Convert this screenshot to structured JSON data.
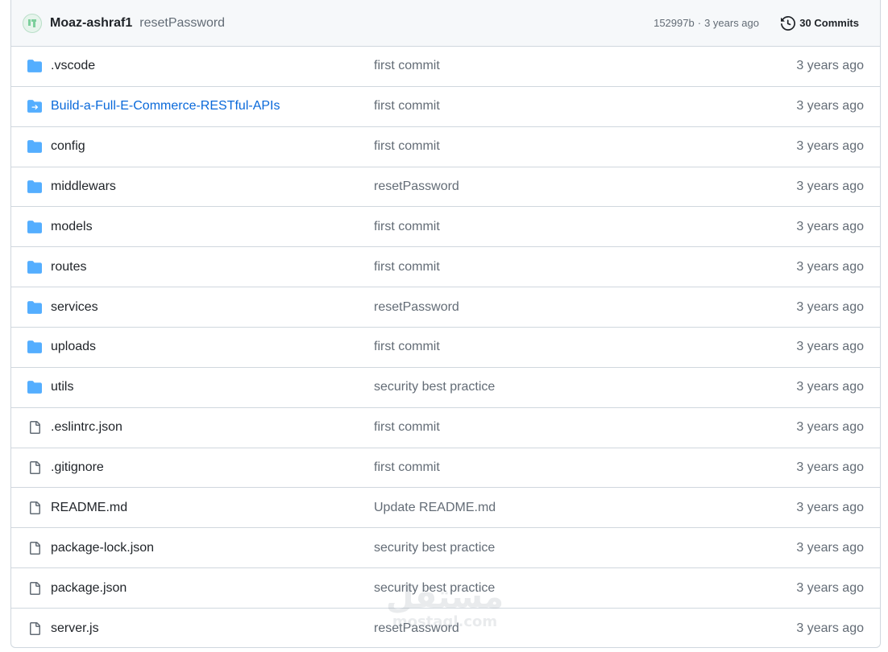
{
  "latest_commit": {
    "author": "Moaz-ashraf1",
    "message": "resetPassword",
    "hash": "152997b",
    "separator": "·",
    "age": "3 years ago",
    "commits_label": "30 Commits"
  },
  "files": [
    {
      "name": ".vscode",
      "type": "folder",
      "message": "first commit",
      "age": "3 years ago"
    },
    {
      "name": "Build-a-Full-E-Commerce-RESTful-APIs",
      "type": "submodule",
      "message": "first commit",
      "age": "3 years ago"
    },
    {
      "name": "config",
      "type": "folder",
      "message": "first commit",
      "age": "3 years ago"
    },
    {
      "name": "middlewars",
      "type": "folder",
      "message": "resetPassword",
      "age": "3 years ago"
    },
    {
      "name": "models",
      "type": "folder",
      "message": "first commit",
      "age": "3 years ago"
    },
    {
      "name": "routes",
      "type": "folder",
      "message": "first commit",
      "age": "3 years ago"
    },
    {
      "name": "services",
      "type": "folder",
      "message": "resetPassword",
      "age": "3 years ago"
    },
    {
      "name": "uploads",
      "type": "folder",
      "message": "first commit",
      "age": "3 years ago"
    },
    {
      "name": "utils",
      "type": "folder",
      "message": "security best practice",
      "age": "3 years ago"
    },
    {
      "name": ".eslintrc.json",
      "type": "file",
      "message": "first commit",
      "age": "3 years ago"
    },
    {
      "name": ".gitignore",
      "type": "file",
      "message": "first commit",
      "age": "3 years ago"
    },
    {
      "name": "README.md",
      "type": "file",
      "message": "Update README.md",
      "age": "3 years ago"
    },
    {
      "name": "package-lock.json",
      "type": "file",
      "message": "security best practice",
      "age": "3 years ago"
    },
    {
      "name": "package.json",
      "type": "file",
      "message": "security best practice",
      "age": "3 years ago"
    },
    {
      "name": "server.js",
      "type": "file",
      "message": "resetPassword",
      "age": "3 years ago"
    }
  ],
  "watermark": {
    "text": "مستقل",
    "domain": "mostaql.com"
  },
  "colors": {
    "folder": "#54aeff",
    "submodule": "#54aeff",
    "file": "#636c76",
    "link": "#0969da",
    "border": "#d0d7de",
    "header_bg": "#f6f8fa"
  }
}
